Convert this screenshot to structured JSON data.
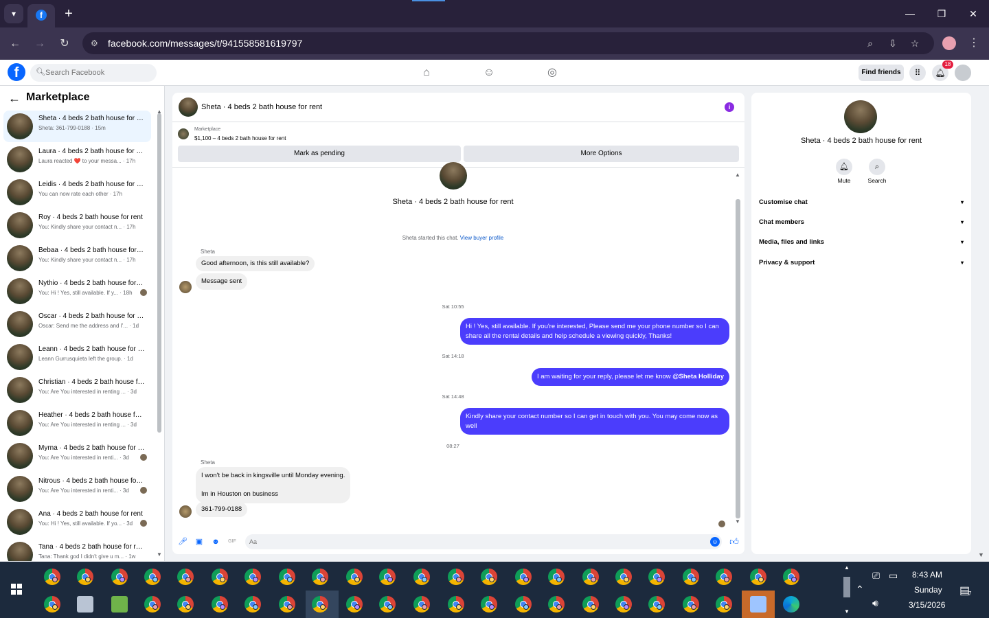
{
  "browser": {
    "url": "facebook.com/messages/t/941558581619797",
    "icons": [
      "chevron-down-icon",
      "facebook-favicon-icon",
      "plus-icon",
      "minimize-icon",
      "restore-icon",
      "close-icon",
      "back-icon",
      "forward-icon",
      "reload-icon",
      "site-settings-icon",
      "zoom-icon",
      "install-app-icon",
      "star-icon",
      "profile-icon",
      "menu-icon"
    ]
  },
  "facebook_header": {
    "search_placeholder": "Search Facebook",
    "find_friends": "Find friends",
    "notification_count": "18",
    "icons": [
      "facebook-logo-icon",
      "home-icon",
      "friends-icon",
      "gaming-icon",
      "apps-grid-icon",
      "bell-icon",
      "account-icon"
    ]
  },
  "sidebar": {
    "title": "Marketplace",
    "conversations": [
      {
        "name": "Sheta · 4 beds 2 bath house for rent",
        "preview": "Sheta: 361-799-0188 · 15m",
        "active": true
      },
      {
        "name": "Laura · 4 beds 2 bath house for rent",
        "preview": "Laura reacted ❤️ to your messa... · 17h"
      },
      {
        "name": "Leidis · 4 beds 2 bath house for rent",
        "preview": "You can now rate each other · 17h"
      },
      {
        "name": "Roy · 4 beds 2 bath house for rent",
        "preview": "You: Kindly share your contact n... · 17h"
      },
      {
        "name": "Bebaa · 4 beds 2 bath house for rent",
        "preview": "You: Kindly share your contact n... · 17h"
      },
      {
        "name": "Nythio · 4 beds 2 bath house for rent",
        "preview": "You: Hi ! Yes, still available. If y... · 18h",
        "seen": true
      },
      {
        "name": "Oscar · 4 beds 2 bath house for rent",
        "preview": "Oscar: Send me the address and I'... · 1d"
      },
      {
        "name": "Leann · 4 beds 2 bath house for rent",
        "preview": "Leann Gurrusquieta left the group. · 1d"
      },
      {
        "name": "Christian · 4 beds 2 bath house for rent",
        "preview": "You: Are You interested in renting ... · 3d"
      },
      {
        "name": "Heather · 4 beds 2 bath house for rent",
        "preview": "You: Are You interested in renting ... · 3d"
      },
      {
        "name": "Myrna · 4 beds 2 bath house for rent",
        "preview": "You: Are You interested in renti... · 3d",
        "seen": true
      },
      {
        "name": "Nitrous · 4 beds 2 bath house for rent",
        "preview": "You: Are You interested in renti... · 3d",
        "seen": true
      },
      {
        "name": "Ana · 4 beds 2 bath house for rent",
        "preview": "You: Hi ! Yes, still available. If yo... · 3d",
        "seen": true
      },
      {
        "name": "Tana · 4 beds 2 bath house for rent",
        "preview": "Tana: Thank god I didn't give u m... · 1w"
      }
    ]
  },
  "chat": {
    "title": "Sheta · 4 beds 2 bath house for rent",
    "marketplace_label": "Marketplace",
    "listing": "$1,100 – 4 beds 2 bath house for rent",
    "mark_pending": "Mark as pending",
    "more_options": "More Options",
    "header_name": "Sheta · 4 beds 2 bath house for rent",
    "started_text": "Sheta started this chat.",
    "buyer_profile_link": "View buyer profile",
    "sender_name": "Sheta",
    "messages": {
      "in1": "Good afternoon, is this still available?",
      "in2": "Message sent",
      "ts1": "Sat 10:55",
      "out1": "Hi ! Yes, still available. If you're interested, Please send me your phone number so I can share all the rental details and help schedule a viewing quickly, Thanks!",
      "ts2": "Sat 14:18",
      "out2_text": "I am waiting for your reply, please let me know ",
      "out2_mention": "@Sheta Holliday",
      "ts3": "Sat 14:48",
      "out3": "Kindly share your contact number so I can get in touch with you. You may come now as well",
      "ts4": "08:27",
      "in3_line1": "I won't be back in kingsville until Monday evening.",
      "in3_line2": "Im in Houston on business",
      "in4": "361-799-0188"
    },
    "composer_placeholder": "Aa",
    "icons": [
      "info-icon",
      "microphone-icon",
      "photo-icon",
      "sticker-icon",
      "gif-icon",
      "emoji-icon",
      "like-icon"
    ]
  },
  "info_panel": {
    "name": "Sheta · 4 beds 2 bath house for rent",
    "mute": "Mute",
    "search": "Search",
    "sections": [
      "Customise chat",
      "Chat members",
      "Media, files and links",
      "Privacy & support"
    ]
  },
  "taskbar": {
    "time": "8:43 AM",
    "day": "Sunday",
    "date": "3/15/2026",
    "notification_count": "7",
    "icons": [
      "windows-start-icon",
      "chrome-icon",
      "notepad-icon",
      "keyboard-icon",
      "edge-icon",
      "meet-now-icon",
      "network-icon",
      "volume-icon",
      "notifications-icon",
      "chevron-up-icon"
    ]
  }
}
